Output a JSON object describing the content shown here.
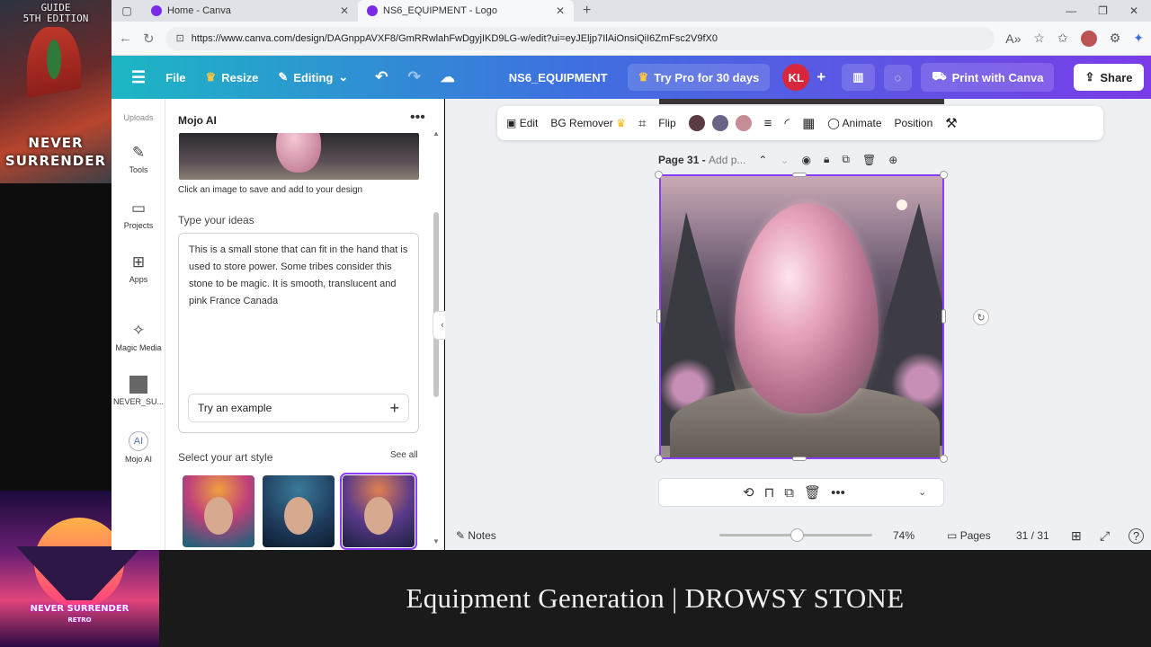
{
  "overlays": {
    "top_card": {
      "line1": "GUIDE",
      "line2": "5TH EDITION",
      "line3": "NEVER",
      "line4": "SURRENDER"
    },
    "bottom_card": {
      "line1": "NEVER SURRENDER",
      "line2": "RETRO"
    },
    "caption": "Equipment Generation | DROWSY STONE"
  },
  "browser": {
    "tabs": [
      {
        "label": "Home - Canva"
      },
      {
        "label": "NS6_EQUIPMENT - Logo"
      }
    ],
    "url": "https://www.canva.com/design/DAGnppAVXF8/GmRRwlahFwDgyjIKD9LG-w/edit?ui=eyJEljp7IlAiOnsiQiI6ZmFsc2V9fX0"
  },
  "header": {
    "file": "File",
    "resize": "Resize",
    "editing": "Editing",
    "title": "NS6_EQUIPMENT",
    "try_pro": "Try Pro for 30 days",
    "avatar": "KL",
    "print": "Print with Canva",
    "share": "Share"
  },
  "rail": {
    "uploads": "Uploads",
    "tools": "Tools",
    "projects": "Projects",
    "apps": "Apps",
    "magic_media": "Magic Media",
    "never": "NEVER_SU...",
    "mojo": "Mojo AI"
  },
  "panel": {
    "title": "Mojo AI",
    "hint": "Click an image to save and add to your design",
    "ideas_label": "Type your ideas",
    "ideas_text": "This is a small stone that can fit in the hand that is used to store power.  Some tribes consider this stone to be magic. It is smooth, translucent and pink France Canada",
    "try_example": "Try an example",
    "art_style_label": "Select your art style",
    "see_all": "See all"
  },
  "canvas": {
    "toolbar": {
      "edit": "Edit",
      "bg_remover": "BG Remover",
      "flip": "Flip",
      "animate": "Animate",
      "position": "Position",
      "swatches": [
        "#5a3a43",
        "#6b6486",
        "#c58d96"
      ]
    },
    "page_label": "Page 31 - ",
    "page_placeholder": "Add p...",
    "footer": {
      "notes": "Notes",
      "zoom": "74%",
      "zoom_level": 0.74,
      "pages": "Pages",
      "page_count": "31 / 31"
    }
  },
  "colors": {
    "accent": "#8b3dff",
    "brand_teal": "#1db6c4",
    "avatar_red": "#d8263a"
  }
}
